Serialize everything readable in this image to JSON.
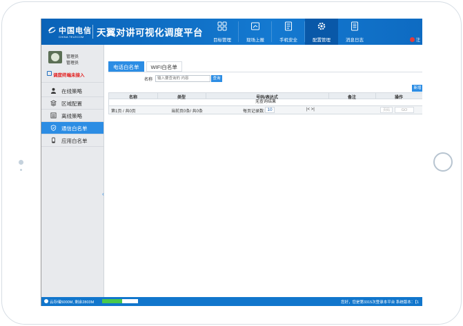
{
  "brand": {
    "logo_cn": "中国电信",
    "logo_en": "CHINA TELECOM",
    "app_title": "天翼对讲可视化调度平台"
  },
  "nav": {
    "items": [
      {
        "label": "目标管理",
        "icon": "grid-icon"
      },
      {
        "label": "现场上报",
        "icon": "report-icon"
      },
      {
        "label": "手机安全",
        "icon": "document-icon"
      },
      {
        "label": "配置管理",
        "icon": "gear-icon"
      },
      {
        "label": "消息日志",
        "icon": "log-icon"
      }
    ],
    "active_index": 3,
    "exit_label": "注"
  },
  "user": {
    "name": "管理员",
    "role": "管理员",
    "terminal_status": "调度终端未接入"
  },
  "sidebar": {
    "items": [
      {
        "label": "在线策略",
        "icon": "user-icon"
      },
      {
        "label": "区域配置",
        "icon": "layers-icon"
      },
      {
        "label": "离线策略",
        "icon": "list-icon"
      },
      {
        "label": "通信白名单",
        "icon": "shield-icon"
      },
      {
        "label": "应用白名单",
        "icon": "phone-icon"
      }
    ],
    "active_index": 3
  },
  "tabs": [
    {
      "label": "电话白名单",
      "active": true
    },
    {
      "label": "WIFI白名单",
      "active": false
    }
  ],
  "search": {
    "label": "名称",
    "placeholder": "输入要查询的 内容",
    "button": "查询"
  },
  "toolbar": {
    "new_label": "新增"
  },
  "table": {
    "headers": [
      "名称",
      "类型",
      "号码/表达式",
      "备注",
      "操作"
    ],
    "empty_text": "无查询结果"
  },
  "pager": {
    "page_info": "第1页 / 共0页",
    "record_info": "当前页0条/ 共0条",
    "page_size_label": "每页记录数:",
    "page_size": "10",
    "nav": "|< >|",
    "jump_placeholder": "页码",
    "go_label": "GO"
  },
  "status": {
    "storage_text": "云存储5000M, 剩余2803M",
    "storage_remaining_fraction": 0.56,
    "right_text": "您好，您是第3315次登录本平台 系统版本：【1"
  },
  "colors": {
    "header": "#1479d0",
    "accent": "#2c8de4",
    "alert": "#e21b1b",
    "storage_fill": "#49c84a"
  }
}
